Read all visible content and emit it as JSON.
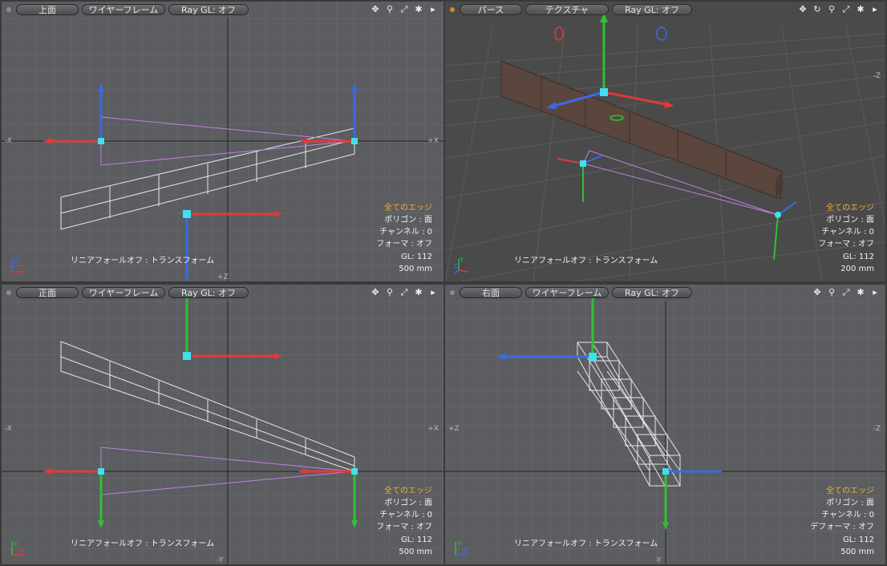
{
  "viewports": [
    {
      "id": "top",
      "view_label": "上面",
      "shading_label": "ワイヤーフレーム",
      "raygl_label": "Ray GL: オフ",
      "axis_labels": {
        "left": "-X",
        "right": "+X",
        "bottom": "+Z"
      },
      "status": "リニアフォールオフ : トランスフォーム",
      "info": {
        "selection": "全てのエッジ",
        "lines": [
          "ポリゴン : 面",
          "チャンネル : 0",
          "フォーマ : オフ",
          "GL: 112",
          "500 mm"
        ]
      },
      "mini_axes": {
        "a": "X",
        "b": "Z"
      }
    },
    {
      "id": "perspective",
      "view_label": "パース",
      "shading_label": "テクスチャ",
      "raygl_label": "Ray GL: オフ",
      "axis_labels": {
        "right": "-Z"
      },
      "status": "リニアフォールオフ : トランスフォーム",
      "info": {
        "selection": "全てのエッジ",
        "lines": [
          "ポリゴン : 面",
          "チャンネル : 0",
          "フォーマ : オフ",
          "GL: 112",
          "200 mm"
        ]
      },
      "mini_axes": {
        "a": "Y",
        "b": "Z"
      }
    },
    {
      "id": "front",
      "view_label": "正面",
      "shading_label": "ワイヤーフレーム",
      "raygl_label": "Ray GL: オフ",
      "axis_labels": {
        "left": "-X",
        "right": "+X",
        "bottom": "-Y"
      },
      "status": "リニアフォールオフ : トランスフォーム",
      "info": {
        "selection": "全てのエッジ",
        "lines": [
          "ポリゴン : 面",
          "チャンネル : 0",
          "フォーマ : オフ",
          "GL: 112",
          "500 mm"
        ]
      },
      "mini_axes": {
        "a": "Y",
        "b": "X"
      }
    },
    {
      "id": "right",
      "view_label": "右面",
      "shading_label": "ワイヤーフレーム",
      "raygl_label": "Ray GL: オフ",
      "axis_labels": {
        "left": "+Z",
        "right": "-Z",
        "bottom": "-Y"
      },
      "status": "リニアフォールオフ : トランスフォーム",
      "info": {
        "selection": "全てのエッジ",
        "lines": [
          "ポリゴン : 面",
          "チャンネル : 0",
          "デフォーマ : オフ",
          "GL: 112",
          "500 mm"
        ]
      },
      "mini_axes": {
        "a": "Y",
        "b": "Z"
      }
    }
  ],
  "toolbar_icons": [
    "move-icon",
    "zoom-icon",
    "fit-icon",
    "settings-icon",
    "menu-arrow-icon"
  ],
  "colors": {
    "viewport_bg": "#5b5d60",
    "perspective_bg": "#4a4a4a",
    "grid": "#6c6e71",
    "wire": "#e8e8e8",
    "falloff": "#c080e0",
    "handle": "#40e0f0",
    "axis_x": "#e03a3a",
    "axis_y": "#30c030",
    "axis_z": "#3a6ae8",
    "selection_text": "#f4b030"
  }
}
